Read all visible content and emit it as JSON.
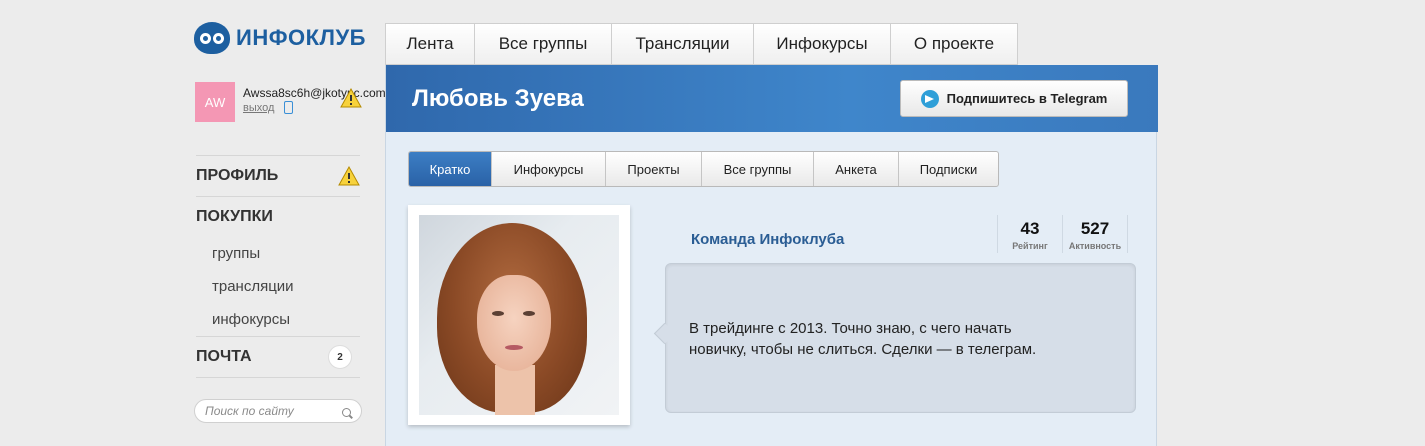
{
  "logo": {
    "text": "ИНФОКЛУБ"
  },
  "user": {
    "avatar_initials": "AW",
    "email": "Awssa8sc6h@jkotypc.com",
    "logout_label": "выход"
  },
  "sidebar": {
    "sections": [
      {
        "label": "ПРОФИЛЬ"
      },
      {
        "label": "ПОКУПКИ"
      }
    ],
    "purchase_items": [
      {
        "label": "группы"
      },
      {
        "label": "трансляции"
      },
      {
        "label": "инфокурсы"
      }
    ],
    "mail": {
      "label": "ПОЧТА",
      "count": "2"
    }
  },
  "search": {
    "placeholder": "Поиск по сайту"
  },
  "topnav": {
    "tabs": [
      {
        "label": "Лента"
      },
      {
        "label": "Все группы"
      },
      {
        "label": "Трансляции"
      },
      {
        "label": "Инфокурсы"
      },
      {
        "label": "О проекте"
      }
    ]
  },
  "profile": {
    "name": "Любовь Зуева",
    "telegram_button": "Подпишитесь в Telegram",
    "team": "Команда Инфоклуба",
    "rating": {
      "value": "43",
      "label": "Рейтинг"
    },
    "activity": {
      "value": "527",
      "label": "Активность"
    },
    "bio": "В трейдинге с 2013. Точно знаю, с чего начать\nновичку, чтобы не слиться. Сделки — в телеграм."
  },
  "subtabs": [
    {
      "label": "Кратко",
      "active": true
    },
    {
      "label": "Инфокурсы"
    },
    {
      "label": "Проекты"
    },
    {
      "label": "Все группы"
    },
    {
      "label": "Анкета"
    },
    {
      "label": "Подписки"
    }
  ],
  "colors": {
    "brand": "#1d5fa0",
    "header": "#3a79bd",
    "active_tab": "#2f6fb6",
    "avatar": "#f497b4"
  }
}
